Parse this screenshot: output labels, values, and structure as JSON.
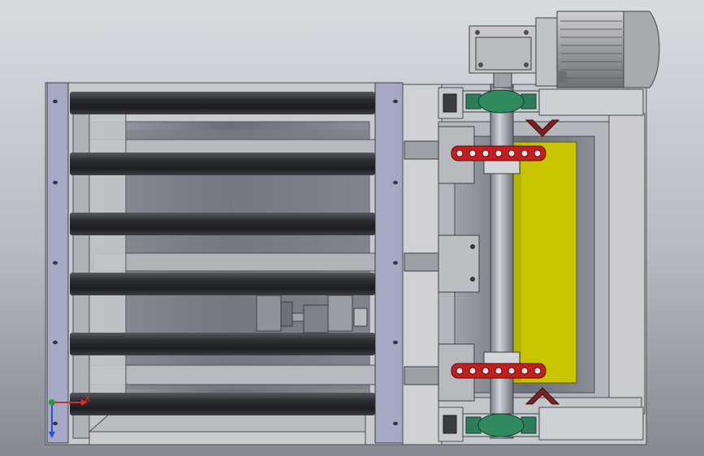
{
  "viewport": {
    "background_top": "#d6dadf",
    "background_mid": "#b9bec6",
    "background_bottom": "#8e939b"
  },
  "colors": {
    "frame": "#c9cbce",
    "frame_dark": "#8c9096",
    "roller": "#2e3134",
    "plate_blue": "#a4a9c4",
    "belt_yellow": "#c7c400",
    "sprocket_red": "#c41e1e",
    "bearing_green": "#2e7d5a",
    "motor_gray": "#a9acae"
  },
  "triad": {
    "x_label": "X",
    "icons": [
      "x-axis-arrow-icon",
      "y-axis-arrow-icon",
      "z-axis-origin-icon"
    ],
    "x_color": "#d62b2b",
    "y_color": "#2a9d3a",
    "z_color": "#2b4fd6"
  }
}
